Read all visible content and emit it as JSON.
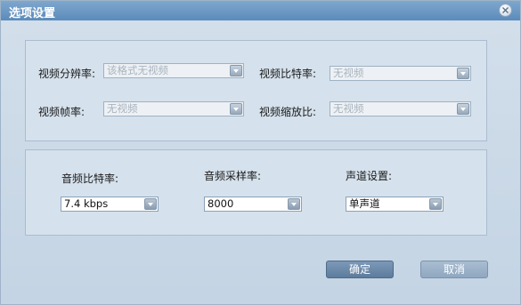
{
  "window": {
    "title": "选项设置"
  },
  "video": {
    "resolution": {
      "label": "视频分辨率:",
      "value": "该格式无视频"
    },
    "bitrate": {
      "label": "视频比特率:",
      "value": "无视频"
    },
    "framerate": {
      "label": "视频帧率:",
      "value": "无视频"
    },
    "aspect": {
      "label": "视频缩放比:",
      "value": "无视频"
    }
  },
  "audio": {
    "bitrate": {
      "label": "音频比特率:",
      "value": "7.4 kbps"
    },
    "samplerate": {
      "label": "音频采样率:",
      "value": "8000"
    },
    "channels": {
      "label": "声道设置:",
      "value": "单声道"
    }
  },
  "buttons": {
    "ok": "确定",
    "cancel": "取消"
  },
  "icons": {
    "close": "close-icon",
    "dropdown": "chevron-down-icon"
  }
}
